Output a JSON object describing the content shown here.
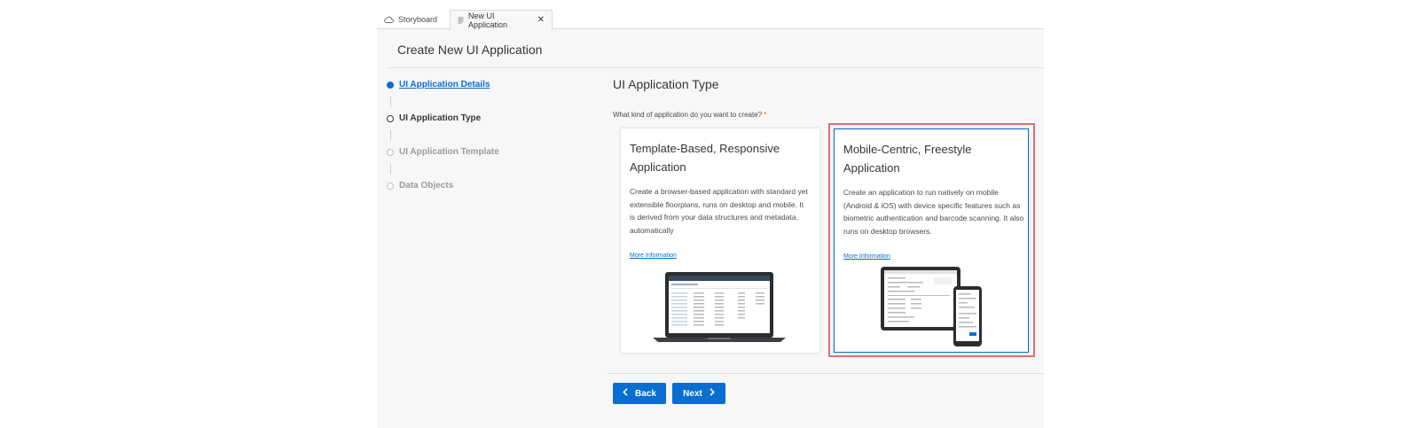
{
  "tabs": [
    {
      "label": "Storyboard",
      "icon": "cloud-icon"
    },
    {
      "label": "New UI Application",
      "icon": "document-icon",
      "close_label": "✕"
    }
  ],
  "page_title": "Create New UI Application",
  "steps": [
    {
      "label": "UI Application Details",
      "state": "current"
    },
    {
      "label": "UI Application Type",
      "state": "active"
    },
    {
      "label": "UI Application Template",
      "state": "disabled"
    },
    {
      "label": "Data Objects",
      "state": "disabled"
    }
  ],
  "section_title": "UI Application Type",
  "question": "What kind of application do you want to create?",
  "required_marker": "*",
  "cards": [
    {
      "title": "Template-Based, Responsive Application",
      "description": "Create a browser-based application with standard yet extensible floorplans, runs on desktop and mobile. It is derived from your data structures and metadata, automatically",
      "more_label": "More Information",
      "illustration": "laptop-illustration"
    },
    {
      "title": "Mobile-Centric, Freestyle Application",
      "description": "Create an application to run natively on mobile (Android & iOS) with device specific features such as biometric authentication and barcode scanning. It also runs on desktop browsers.",
      "more_label": "More Information",
      "illustration": "tablet-phone-illustration",
      "selected": true
    }
  ],
  "buttons": {
    "back": "Back",
    "next": "Next"
  },
  "colors": {
    "accent": "#0a6ed1",
    "highlight": "#e06f6f",
    "required": "#e9730c"
  }
}
